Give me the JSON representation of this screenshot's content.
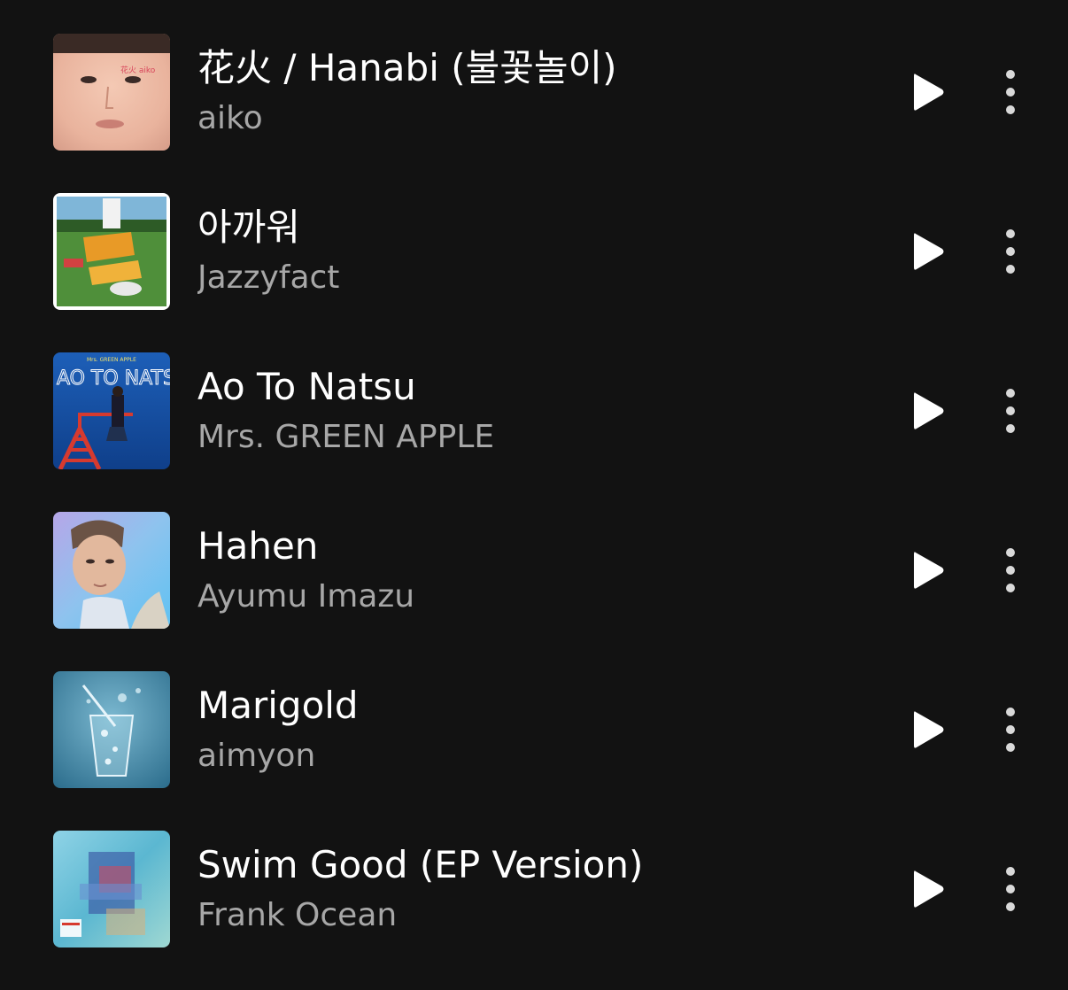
{
  "tracks": [
    {
      "title": "花火 / Hanabi (불꽃놀이)",
      "artist": "aiko",
      "cover_icon": "portrait-face-cover"
    },
    {
      "title": "아까워",
      "artist": "Jazzyfact",
      "cover_icon": "grass-field-cover"
    },
    {
      "title": "Ao To Natsu",
      "artist": "Mrs. GREEN APPLE",
      "cover_icon": "blue-sky-tower-cover",
      "cover_text": {
        "band": "Mrs. GREEN APPLE",
        "logo": "AO TO NATSU"
      }
    },
    {
      "title": "Hahen",
      "artist": "Ayumu Imazu",
      "cover_icon": "portrait-cover"
    },
    {
      "title": "Marigold",
      "artist": "aimyon",
      "cover_icon": "soda-glass-cover"
    },
    {
      "title": "Swim Good (EP Version)",
      "artist": "Frank Ocean",
      "cover_icon": "blurred-collage-cover"
    }
  ],
  "icons": {
    "play": "play-icon",
    "more": "more-vertical-icon"
  },
  "colors": {
    "background": "#121212",
    "title": "#ffffff",
    "artist": "#a7a7a7",
    "icon": "#ffffff",
    "more_icon": "#d9d9d9"
  }
}
